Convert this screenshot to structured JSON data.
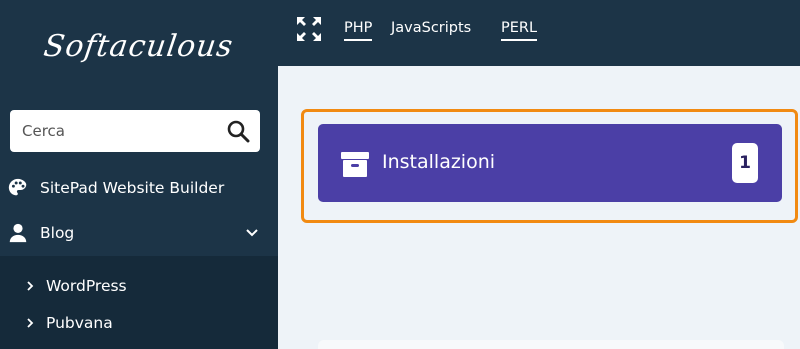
{
  "app": {
    "logo_text": "Softaculous"
  },
  "sidebar": {
    "search": {
      "placeholder": "Cerca",
      "value": ""
    },
    "items": [
      {
        "label": "SitePad Website Builder",
        "icon": "palette-icon"
      },
      {
        "label": "Blog",
        "icon": "user-icon",
        "expanded": true
      }
    ],
    "subitems": [
      {
        "label": "WordPress"
      },
      {
        "label": "Pubvana"
      }
    ]
  },
  "topbar": {
    "tabs": [
      {
        "label": "PHP",
        "active": true
      },
      {
        "label": "JavaScripts",
        "active": false
      },
      {
        "label": "PERL",
        "active": true
      }
    ]
  },
  "main": {
    "installations": {
      "label": "Installazioni",
      "count": "1"
    }
  },
  "colors": {
    "sidebar_bg": "#1c3447",
    "submenu_bg": "#152a3a",
    "card_bg": "#4b3fa6",
    "highlight": "#f18a12",
    "main_bg": "#eef3f8"
  }
}
